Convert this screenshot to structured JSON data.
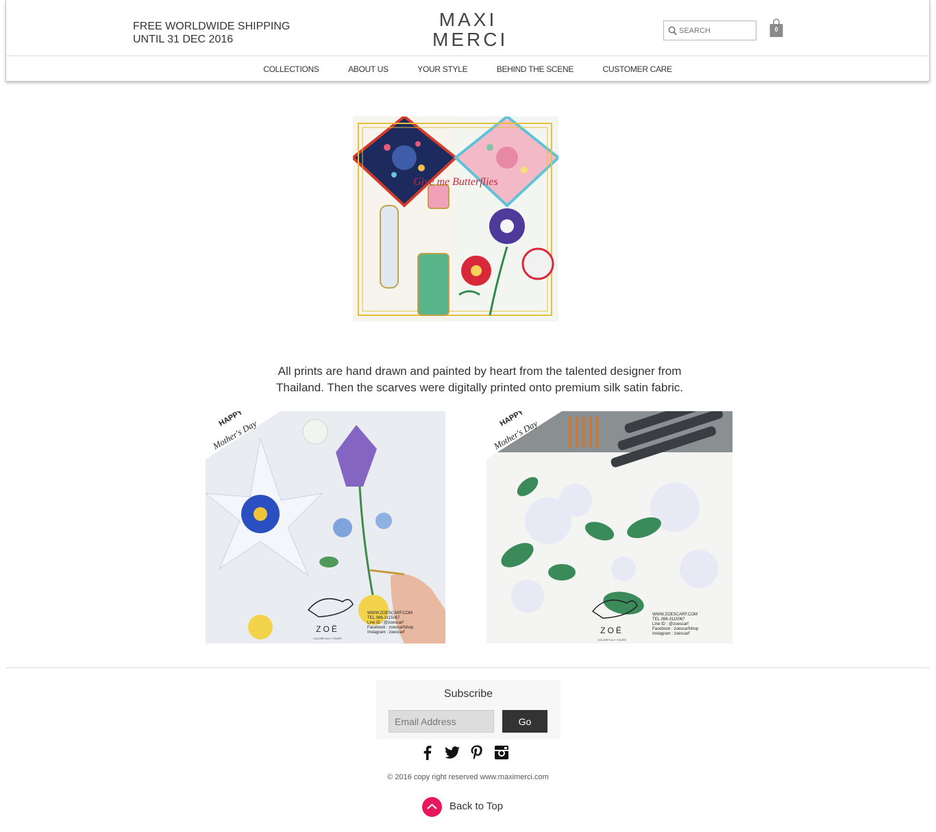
{
  "header": {
    "shipping_line1": "FREE WORLDWIDE SHIPPING",
    "shipping_line2": "UNTIL 31 DEC 2016",
    "logo_line1": "MAXI",
    "logo_line2": "MERCI",
    "search_placeholder": "SEARCH",
    "cart_count": "0"
  },
  "nav": {
    "items": [
      "COLLECTIONS",
      "ABOUT US",
      "YOUR STYLE",
      "BEHIND THE SCENE",
      "CUSTOMER CARE"
    ]
  },
  "hero": {
    "script_text": "Give me Butterflies"
  },
  "description": "All prints are hand drawn and painted by heart from the talented designer from Thailand. Then the scarves were digitally printed onto premium silk satin fabric.",
  "photos": {
    "badge_line1": "HAPPY",
    "badge_line2": "Mother's Day",
    "brand": "ZOË",
    "brand_tagline": "COLORFULLY YOURS",
    "contact": [
      "WWW.ZOESCARF.COM",
      "TEL.086-3115067",
      "Line ID : @zoescarf",
      "Facebook : zoescarfshop",
      "Instagram : zoescarf"
    ]
  },
  "subscribe": {
    "title": "Subscribe",
    "email_placeholder": "Email Address",
    "button": "Go"
  },
  "social": [
    "facebook-icon",
    "twitter-icon",
    "pinterest-icon",
    "instagram-icon"
  ],
  "footer": {
    "copyright": "© 2016 copy right reserved www.maximerci.com",
    "back_to_top": "Back to Top"
  },
  "colors": {
    "accent_pink": "#e8175d",
    "dark_button": "#333333"
  }
}
